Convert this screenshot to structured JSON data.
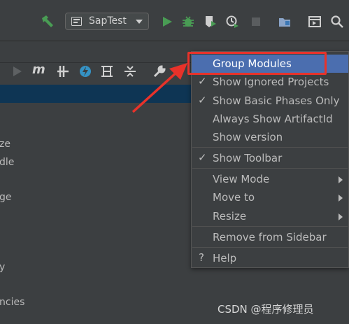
{
  "toolbar": {
    "run_config": "SapTest"
  },
  "left_fragments": [
    "ze",
    "dle",
    "ge",
    "y",
    "ncies"
  ],
  "menu": {
    "items": [
      {
        "label": "Group Modules",
        "checked": false,
        "submenu": false,
        "active": true
      },
      {
        "label": "Show Ignored Projects",
        "checked": true,
        "submenu": false,
        "active": false
      },
      {
        "label": "Show Basic Phases Only",
        "checked": true,
        "submenu": false,
        "active": false
      },
      {
        "label": "Always Show ArtifactId",
        "checked": false,
        "submenu": false,
        "active": false
      },
      {
        "label": "Show version",
        "checked": false,
        "submenu": false,
        "active": false
      },
      {
        "label": "Show Toolbar",
        "checked": true,
        "submenu": false,
        "active": false
      },
      {
        "label": "View Mode",
        "checked": false,
        "submenu": true,
        "active": false
      },
      {
        "label": "Move to",
        "checked": false,
        "submenu": true,
        "active": false
      },
      {
        "label": "Resize",
        "checked": false,
        "submenu": true,
        "active": false
      },
      {
        "label": "Remove from Sidebar",
        "checked": false,
        "submenu": false,
        "active": false
      },
      {
        "label": "Help",
        "checked": false,
        "submenu": false,
        "active": false
      }
    ],
    "check_glyph": "✓",
    "help_glyph": "?"
  },
  "watermark": "CSDN @程序修理员",
  "colors": {
    "background": "#3c3f41",
    "menu_active": "#4b6eaf",
    "annotation": "#e8322a",
    "run_green": "#499c54"
  }
}
